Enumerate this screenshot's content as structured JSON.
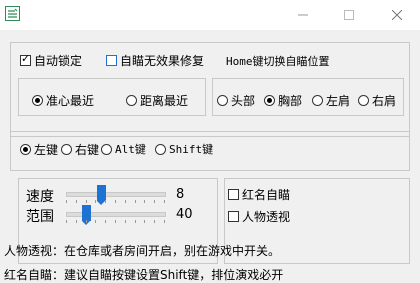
{
  "window": {
    "title": ""
  },
  "options": {
    "auto_lock": {
      "label": "自动锁定",
      "checked": true
    },
    "no_recoil": {
      "label": "自瞄无效果修复",
      "checked": false
    },
    "home_hint": "Home键切换自瞄位置"
  },
  "aim_mode": [
    {
      "label": "准心最近",
      "selected": true
    },
    {
      "label": "距离最近",
      "selected": false
    }
  ],
  "aim_target": [
    {
      "label": "头部",
      "selected": false
    },
    {
      "label": "胸部",
      "selected": true
    },
    {
      "label": "左肩",
      "selected": false
    },
    {
      "label": "右肩",
      "selected": false
    }
  ],
  "aim_key": [
    {
      "label": "左键",
      "selected": true
    },
    {
      "label": "右键",
      "selected": false
    },
    {
      "label": "Alt键",
      "selected": false
    },
    {
      "label": "Shift键",
      "selected": false
    }
  ],
  "sliders": {
    "speed": {
      "label": "速度",
      "value": "8",
      "fraction": 0.36
    },
    "range": {
      "label": "范围",
      "value": "40",
      "fraction": 0.2
    }
  },
  "toggles": {
    "red_name": {
      "label": "红名自瞄",
      "checked": false
    },
    "esp": {
      "label": "人物透视",
      "checked": false
    }
  },
  "notes": {
    "esp_note": "人物透视：在仓库或者房间开启，别在游戏中开关。",
    "red_note": "红名自瞄：建议自瞄按键设置Shift键，排位演戏必开"
  },
  "icons": {
    "app": "app-logo-icon",
    "minimize": "minimize-icon",
    "maximize": "maximize-icon",
    "close": "close-icon"
  }
}
